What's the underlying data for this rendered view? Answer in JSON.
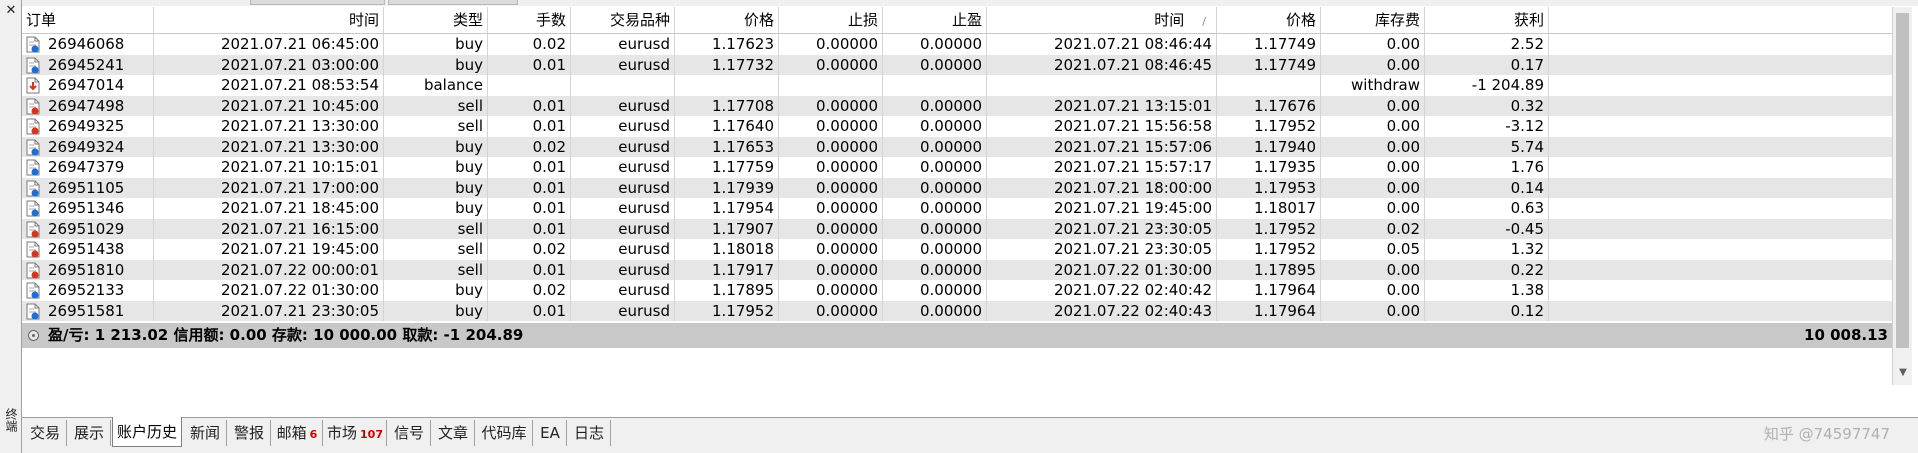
{
  "columns": [
    "订单",
    "时间",
    "类型",
    "手数",
    "交易品种",
    "价格",
    "止损",
    "止盈",
    "时间",
    "价格",
    "库存费",
    "获利"
  ],
  "sort_indicator": "/",
  "rows": [
    {
      "order": "26946068",
      "time": "2021.07.21 06:45:00",
      "type": "buy",
      "lots": "0.02",
      "symbol": "eurusd",
      "price": "1.17623",
      "sl": "0.00000",
      "tp": "0.00000",
      "close_time": "2021.07.21 08:46:44",
      "close_price": "1.17749",
      "swap": "0.00",
      "profit": "2.52",
      "icon": "buy"
    },
    {
      "order": "26945241",
      "time": "2021.07.21 03:00:00",
      "type": "buy",
      "lots": "0.01",
      "symbol": "eurusd",
      "price": "1.17732",
      "sl": "0.00000",
      "tp": "0.00000",
      "close_time": "2021.07.21 08:46:45",
      "close_price": "1.17749",
      "swap": "0.00",
      "profit": "0.17",
      "icon": "buy"
    },
    {
      "order": "26947014",
      "time": "2021.07.21 08:53:54",
      "type": "balance",
      "lots": "",
      "symbol": "",
      "price": "",
      "sl": "",
      "tp": "",
      "close_time": "",
      "close_price": "",
      "swap": "withdraw",
      "profit": "-1 204.89",
      "icon": "balance"
    },
    {
      "order": "26947498",
      "time": "2021.07.21 10:45:00",
      "type": "sell",
      "lots": "0.01",
      "symbol": "eurusd",
      "price": "1.17708",
      "sl": "0.00000",
      "tp": "0.00000",
      "close_time": "2021.07.21 13:15:01",
      "close_price": "1.17676",
      "swap": "0.00",
      "profit": "0.32",
      "icon": "sell"
    },
    {
      "order": "26949325",
      "time": "2021.07.21 13:30:00",
      "type": "sell",
      "lots": "0.01",
      "symbol": "eurusd",
      "price": "1.17640",
      "sl": "0.00000",
      "tp": "0.00000",
      "close_time": "2021.07.21 15:56:58",
      "close_price": "1.17952",
      "swap": "0.00",
      "profit": "-3.12",
      "icon": "sell"
    },
    {
      "order": "26949324",
      "time": "2021.07.21 13:30:00",
      "type": "buy",
      "lots": "0.02",
      "symbol": "eurusd",
      "price": "1.17653",
      "sl": "0.00000",
      "tp": "0.00000",
      "close_time": "2021.07.21 15:57:06",
      "close_price": "1.17940",
      "swap": "0.00",
      "profit": "5.74",
      "icon": "buy"
    },
    {
      "order": "26947379",
      "time": "2021.07.21 10:15:01",
      "type": "buy",
      "lots": "0.01",
      "symbol": "eurusd",
      "price": "1.17759",
      "sl": "0.00000",
      "tp": "0.00000",
      "close_time": "2021.07.21 15:57:17",
      "close_price": "1.17935",
      "swap": "0.00",
      "profit": "1.76",
      "icon": "buy"
    },
    {
      "order": "26951105",
      "time": "2021.07.21 17:00:00",
      "type": "buy",
      "lots": "0.01",
      "symbol": "eurusd",
      "price": "1.17939",
      "sl": "0.00000",
      "tp": "0.00000",
      "close_time": "2021.07.21 18:00:00",
      "close_price": "1.17953",
      "swap": "0.00",
      "profit": "0.14",
      "icon": "buy"
    },
    {
      "order": "26951346",
      "time": "2021.07.21 18:45:00",
      "type": "buy",
      "lots": "0.01",
      "symbol": "eurusd",
      "price": "1.17954",
      "sl": "0.00000",
      "tp": "0.00000",
      "close_time": "2021.07.21 19:45:00",
      "close_price": "1.18017",
      "swap": "0.00",
      "profit": "0.63",
      "icon": "buy"
    },
    {
      "order": "26951029",
      "time": "2021.07.21 16:15:00",
      "type": "sell",
      "lots": "0.01",
      "symbol": "eurusd",
      "price": "1.17907",
      "sl": "0.00000",
      "tp": "0.00000",
      "close_time": "2021.07.21 23:30:05",
      "close_price": "1.17952",
      "swap": "0.02",
      "profit": "-0.45",
      "icon": "sell"
    },
    {
      "order": "26951438",
      "time": "2021.07.21 19:45:00",
      "type": "sell",
      "lots": "0.02",
      "symbol": "eurusd",
      "price": "1.18018",
      "sl": "0.00000",
      "tp": "0.00000",
      "close_time": "2021.07.21 23:30:05",
      "close_price": "1.17952",
      "swap": "0.05",
      "profit": "1.32",
      "icon": "sell"
    },
    {
      "order": "26951810",
      "time": "2021.07.22 00:00:01",
      "type": "sell",
      "lots": "0.01",
      "symbol": "eurusd",
      "price": "1.17917",
      "sl": "0.00000",
      "tp": "0.00000",
      "close_time": "2021.07.22 01:30:00",
      "close_price": "1.17895",
      "swap": "0.00",
      "profit": "0.22",
      "icon": "sell"
    },
    {
      "order": "26952133",
      "time": "2021.07.22 01:30:00",
      "type": "buy",
      "lots": "0.02",
      "symbol": "eurusd",
      "price": "1.17895",
      "sl": "0.00000",
      "tp": "0.00000",
      "close_time": "2021.07.22 02:40:42",
      "close_price": "1.17964",
      "swap": "0.00",
      "profit": "1.38",
      "icon": "buy"
    },
    {
      "order": "26951581",
      "time": "2021.07.21 23:30:05",
      "type": "buy",
      "lots": "0.01",
      "symbol": "eurusd",
      "price": "1.17952",
      "sl": "0.00000",
      "tp": "0.00000",
      "close_time": "2021.07.22 02:40:43",
      "close_price": "1.17964",
      "swap": "0.00",
      "profit": "0.12",
      "icon": "buy"
    }
  ],
  "summary": {
    "text": "盈/亏: 1 213.02  信用额: 0.00  存款: 10 000.00  取款: -1 204.89",
    "balance": "10 008.13"
  },
  "side_label": "终端",
  "close_icon": "close-icon",
  "tabs": [
    {
      "label": "交易",
      "badge": ""
    },
    {
      "label": "展示",
      "badge": ""
    },
    {
      "label": "账户历史",
      "badge": "",
      "active": true
    },
    {
      "label": "新闻",
      "badge": ""
    },
    {
      "label": "警报",
      "badge": ""
    },
    {
      "label": "邮箱",
      "badge": "6"
    },
    {
      "label": "市场",
      "badge": "107"
    },
    {
      "label": "信号",
      "badge": ""
    },
    {
      "label": "文章",
      "badge": ""
    },
    {
      "label": "代码库",
      "badge": ""
    },
    {
      "label": "EA",
      "badge": ""
    },
    {
      "label": "日志",
      "badge": ""
    }
  ],
  "watermark": "知乎 @74597747",
  "colors": {
    "row_even": "#e6e6e6",
    "summary_bg": "#c8c8c8",
    "badge": "#d00000",
    "buy_icon": "#1a6fd6",
    "sell_icon": "#d8341c"
  }
}
